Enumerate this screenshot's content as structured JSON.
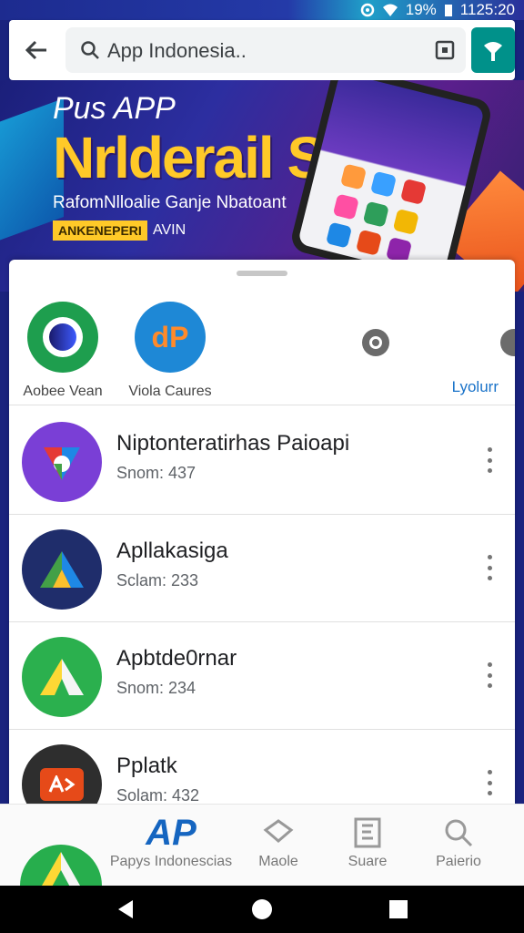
{
  "status": {
    "battery": "19%",
    "time": "1125:20"
  },
  "header": {
    "search_text": "App Indonesia.."
  },
  "banner": {
    "subtitle": "Pus APP",
    "title": "Nrlderail SII",
    "tagline": "RafomNlloalie Ganje Nbatoant",
    "badge": "ANKENEPERI",
    "badge_extra": "AVIN"
  },
  "quick": {
    "items": [
      {
        "label": "Aobee Vean"
      },
      {
        "label": "Viola Caures"
      }
    ],
    "app_icon_text": "dP",
    "layout_link": "Lyolurr"
  },
  "apps": [
    {
      "name": "Niptonteratirhas Paioapi",
      "meta": "Snom: 437"
    },
    {
      "name": "Apllakasiga",
      "meta": "Sclam: 233"
    },
    {
      "name": "Apbtde0rnar",
      "meta": "Snom: 234"
    },
    {
      "name": "Pplatk",
      "meta": "Solam: 432"
    }
  ],
  "bottom_nav": {
    "items": [
      {
        "label": "Papys Indonescias",
        "icon_text": "AP",
        "active": true
      },
      {
        "label": "Maole",
        "active": false
      },
      {
        "label": "Suare",
        "active": false
      },
      {
        "label": "Paierio",
        "active": false
      }
    ]
  },
  "colors": {
    "accent": "#00918a",
    "link": "#1a73c9",
    "active_nav": "#1565c0"
  }
}
